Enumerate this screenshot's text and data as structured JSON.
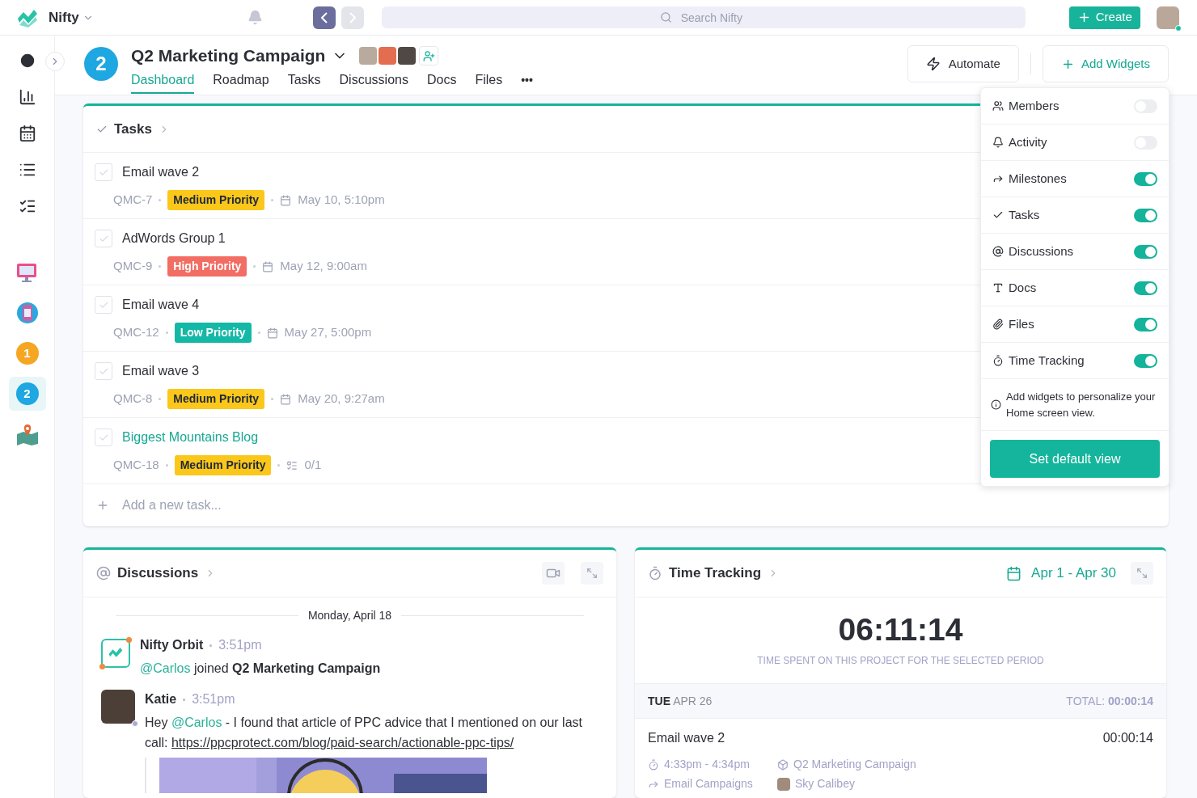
{
  "topbar": {
    "workspace": "Nifty",
    "search": {
      "placeholder": "Search Nifty"
    },
    "create": "Create"
  },
  "sidebar": {
    "projects": [
      {
        "kind": "monitor",
        "selected": false
      },
      {
        "kind": "phone",
        "selected": false
      },
      {
        "kind": "number",
        "label": "1",
        "color": "#f5a623",
        "selected": false
      },
      {
        "kind": "number",
        "label": "2",
        "color": "#1ea7e1",
        "selected": true
      },
      {
        "kind": "map",
        "selected": false
      }
    ]
  },
  "project": {
    "badge": "2",
    "title": "Q2 Marketing Campaign",
    "tabs": [
      {
        "label": "Dashboard",
        "selected": true
      },
      {
        "label": "Roadmap",
        "selected": false
      },
      {
        "label": "Tasks",
        "selected": false
      },
      {
        "label": "Discussions",
        "selected": false
      },
      {
        "label": "Docs",
        "selected": false
      },
      {
        "label": "Files",
        "selected": false
      }
    ],
    "more": "•••",
    "actions": [
      "Automate",
      "Add Widgets"
    ]
  },
  "tasks": {
    "title": "Tasks",
    "items": [
      {
        "title": "Email wave 2",
        "id": "QMC-7",
        "priority": {
          "label": "Medium Priority",
          "color": "#fbc71a"
        },
        "meta": {
          "kind": "date",
          "text": "May 10, 5:10pm"
        },
        "checked": false,
        "highlighted": false
      },
      {
        "title": "AdWords Group 1",
        "id": "QMC-9",
        "priority": {
          "label": "High Priority",
          "color": "#f26d63"
        },
        "meta": {
          "kind": "date",
          "text": "May 12, 9:00am"
        },
        "checked": false,
        "highlighted": false
      },
      {
        "title": "Email wave 4",
        "id": "QMC-12",
        "priority": {
          "label": "Low Priority",
          "color": "#14b8a6"
        },
        "meta": {
          "kind": "date",
          "text": "May 27, 5:00pm"
        },
        "checked": false,
        "highlighted": false
      },
      {
        "title": "Email wave 3",
        "id": "QMC-8",
        "priority": {
          "label": "Medium Priority",
          "color": "#fbc71a"
        },
        "meta": {
          "kind": "date",
          "text": "May 20, 9:27am"
        },
        "checked": false,
        "highlighted": false
      },
      {
        "title": "Biggest Mountains Blog",
        "id": "QMC-18",
        "priority": {
          "label": "Medium Priority",
          "color": "#fbc71a"
        },
        "meta": {
          "kind": "subtasks",
          "text": "0/1"
        },
        "checked": false,
        "highlighted": true
      }
    ],
    "add_placeholder": "Add a new task..."
  },
  "widgets": {
    "items": [
      {
        "label": "Members",
        "on": false
      },
      {
        "label": "Activity",
        "on": false
      },
      {
        "label": "Milestones",
        "on": true
      },
      {
        "label": "Tasks",
        "on": true
      },
      {
        "label": "Discussions",
        "on": true
      },
      {
        "label": "Docs",
        "on": true
      },
      {
        "label": "Files",
        "on": true
      },
      {
        "label": "Time Tracking",
        "on": true
      }
    ],
    "hint": "Add widgets to personalize your Home screen view.",
    "button": "Set default view"
  },
  "discussions": {
    "title": "Discussions",
    "date": "Monday, April 18",
    "messages": [
      {
        "author": "Nifty Orbit",
        "kind": "bot",
        "time": "3:51pm",
        "parts": [
          {
            "kind": "mention",
            "text": "@Carlos"
          },
          {
            "kind": "text",
            "text": " joined "
          },
          {
            "kind": "bold",
            "text": "Q2 Marketing Campaign"
          }
        ]
      },
      {
        "author": "Katie",
        "kind": "person",
        "time": "3:51pm",
        "parts": [
          {
            "kind": "text",
            "text": "Hey "
          },
          {
            "kind": "mention",
            "text": "@Carlos"
          },
          {
            "kind": "text",
            "text": " - I found that article of PPC advice that I mentioned on our last call: "
          },
          {
            "kind": "link",
            "text": "https://ppcprotect.com/blog/paid-search/actionable-ppc-tips/"
          }
        ],
        "attachment": {
          "kind": "picture"
        }
      }
    ]
  },
  "time_tracking": {
    "title": "Time Tracking",
    "range": "Apr 1 - Apr 30",
    "total_time": "06:11:14",
    "caption": "TIME SPENT ON THIS PROJECT FOR THE SELECTED PERIOD",
    "day": {
      "weekday": "TUE",
      "date": "APR 26",
      "total_label": "TOTAL:",
      "total": "00:00:14"
    },
    "entries": [
      {
        "title": "Email wave 2",
        "duration": "00:00:14",
        "span": "4:33pm - 4:34pm",
        "project": "Q2 Marketing Campaign",
        "milestone": "Email Campaigns",
        "user": "Sky Calibey"
      }
    ]
  }
}
